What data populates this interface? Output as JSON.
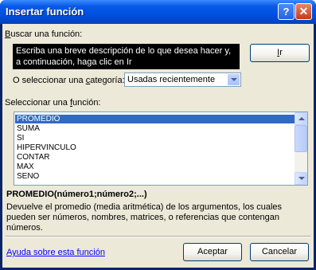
{
  "window": {
    "title": "Insertar función",
    "help_glyph": "?",
    "close_glyph": "✕"
  },
  "search": {
    "label_pre": "",
    "label_key": "B",
    "label_post": "uscar una función:",
    "text": "Escriba una breve descripción de lo que desea hacer y, a continuación, haga clic en Ir",
    "go_key": "I",
    "go_post": "r"
  },
  "category": {
    "label_pre": "O seleccionar una ",
    "label_key": "c",
    "label_post": "ategoría:",
    "selected": "Usadas recientemente"
  },
  "functions": {
    "label_pre": "Seleccionar una ",
    "label_key": "f",
    "label_post": "unción:",
    "items": [
      "PROMEDIO",
      "SUMA",
      "SI",
      "HIPERVINCULO",
      "CONTAR",
      "MAX",
      "SENO"
    ],
    "selected_index": 0
  },
  "details": {
    "signature": "PROMEDIO(número1;número2;...)",
    "description": "Devuelve el promedio (media aritmética) de los argumentos, los cuales pueden ser números, nombres, matrices, o referencias que contengan números."
  },
  "footer": {
    "help_link": "Ayuda sobre esta función",
    "ok": "Aceptar",
    "cancel": "Cancelar"
  }
}
